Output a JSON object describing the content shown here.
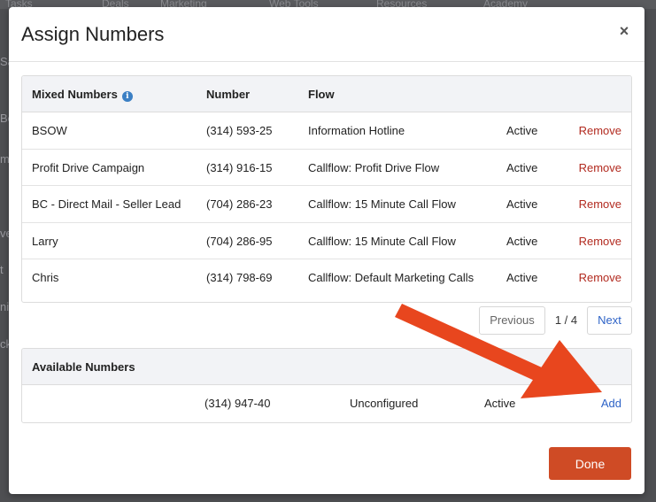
{
  "background": {
    "nav": [
      "Tasks",
      "Deals",
      "Marketing",
      "Web Tools",
      "Resources",
      "Academy"
    ],
    "side": [
      "Sa",
      "Bo",
      "m",
      "ve",
      "t",
      "ni",
      "ck"
    ]
  },
  "modal": {
    "title": "Assign Numbers",
    "close_icon": "×",
    "assigned": {
      "headers": {
        "name": "Mixed Numbers",
        "number": "Number",
        "flow": "Flow"
      },
      "info_icon": "i",
      "rows": [
        {
          "name": "BSOW",
          "number": "(314) 593-25",
          "flow": "Information Hotline",
          "status": "Active",
          "action": "Remove"
        },
        {
          "name": "Profit Drive Campaign",
          "number": "(314) 916-15",
          "flow": "Callflow: Profit Drive Flow",
          "status": "Active",
          "action": "Remove"
        },
        {
          "name": "BC - Direct Mail - Seller Lead",
          "number": "(704) 286-23",
          "flow": "Callflow: 15 Minute Call Flow",
          "status": "Active",
          "action": "Remove"
        },
        {
          "name": "Larry",
          "number": "(704) 286-95",
          "flow": "Callflow: 15 Minute Call Flow",
          "status": "Active",
          "action": "Remove"
        },
        {
          "name": "Chris",
          "number": "(314) 798-69",
          "flow": "Callflow: Default Marketing Calls",
          "status": "Active",
          "action": "Remove"
        }
      ]
    },
    "pagination": {
      "previous": "Previous",
      "page": "1 / 4",
      "next": "Next"
    },
    "available": {
      "header": "Available Numbers",
      "rows": [
        {
          "number": "(314) 947-40",
          "flow": "Unconfigured",
          "status": "Active",
          "action": "Add"
        }
      ]
    },
    "done_label": "Done"
  },
  "colors": {
    "remove": "#b22a1f",
    "link": "#2e63c7",
    "done": "#cf4b25",
    "arrow": "#e8461e"
  }
}
